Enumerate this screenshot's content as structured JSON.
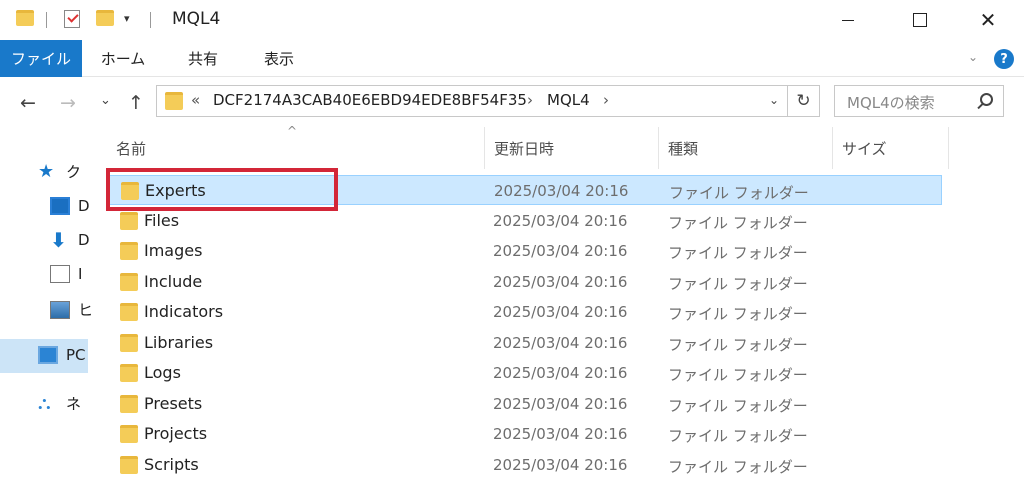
{
  "window": {
    "title": "MQL4",
    "qa_dropdown": "▾",
    "minimize_label": "",
    "maximize_label": "",
    "close_label": "✕"
  },
  "ribbon": {
    "tabs": [
      "ファイル",
      "ホーム",
      "共有",
      "表示"
    ],
    "collapse": "⌄",
    "help": "?"
  },
  "address": {
    "back": "←",
    "forward": "→",
    "recent": "⌄",
    "up": "↑",
    "overflow": "«",
    "crumbs": [
      "DCF2174A3CAB40E6EBD94EDE8BF54F35",
      "MQL4"
    ],
    "sep1": "›",
    "sep2": "›",
    "dropdown": "⌄",
    "refresh": "↻"
  },
  "search": {
    "placeholder": "MQL4の検索"
  },
  "navpane": {
    "items": [
      "ク",
      "D",
      "D",
      "I",
      "ヒ",
      "PC",
      "ネ"
    ]
  },
  "columns": [
    "名前",
    "更新日時",
    "種類",
    "サイズ"
  ],
  "sort_indicator": "^",
  "files": [
    {
      "name": "Experts",
      "date": "2025/03/04 20:16",
      "type": "ファイル フォルダー"
    },
    {
      "name": "Files",
      "date": "2025/03/04 20:16",
      "type": "ファイル フォルダー"
    },
    {
      "name": "Images",
      "date": "2025/03/04 20:16",
      "type": "ファイル フォルダー"
    },
    {
      "name": "Include",
      "date": "2025/03/04 20:16",
      "type": "ファイル フォルダー"
    },
    {
      "name": "Indicators",
      "date": "2025/03/04 20:16",
      "type": "ファイル フォルダー"
    },
    {
      "name": "Libraries",
      "date": "2025/03/04 20:16",
      "type": "ファイル フォルダー"
    },
    {
      "name": "Logs",
      "date": "2025/03/04 20:16",
      "type": "ファイル フォルダー"
    },
    {
      "name": "Presets",
      "date": "2025/03/04 20:16",
      "type": "ファイル フォルダー"
    },
    {
      "name": "Projects",
      "date": "2025/03/04 20:16",
      "type": "ファイル フォルダー"
    },
    {
      "name": "Scripts",
      "date": "2025/03/04 20:16",
      "type": "ファイル フォルダー"
    }
  ],
  "colors": {
    "accent": "#1979ca",
    "selection": "#cce8ff",
    "highlight_box": "#d32638",
    "folder": "#f4cc58"
  },
  "icons": [
    "folder-icon",
    "checkmark-icon",
    "search-icon",
    "refresh-icon",
    "help-icon",
    "star-icon",
    "desktop-icon",
    "download-icon",
    "document-icon",
    "pictures-icon",
    "pc-icon",
    "network-icon"
  ]
}
